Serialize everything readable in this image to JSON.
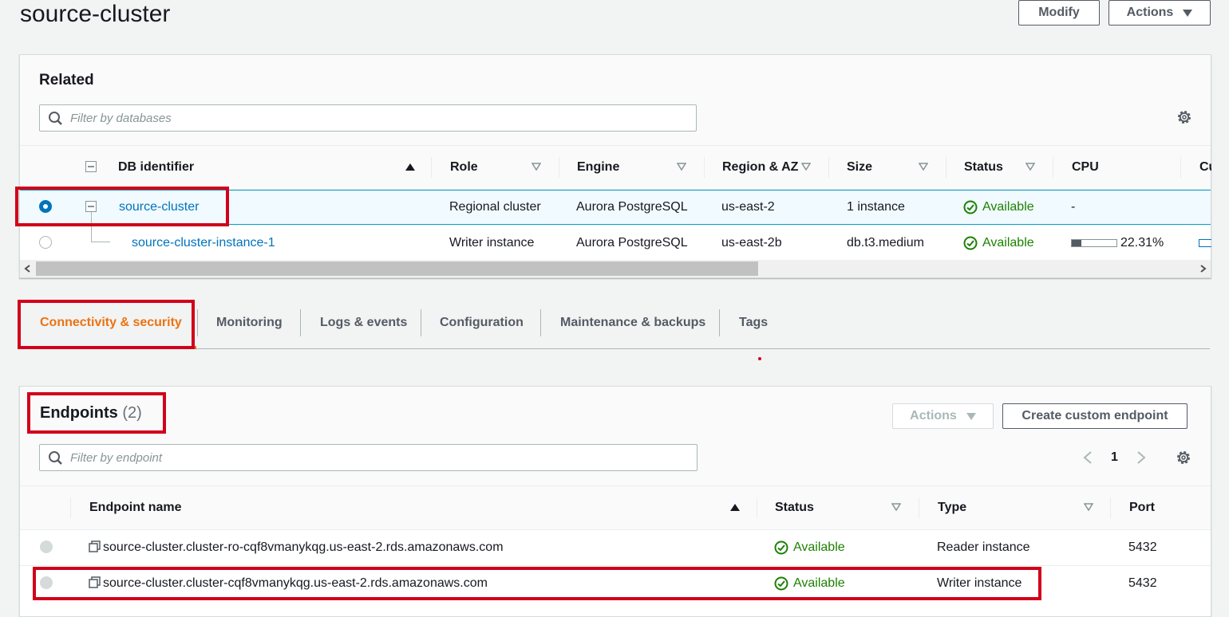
{
  "page": {
    "title": "source-cluster",
    "modify_label": "Modify",
    "actions_label": "Actions"
  },
  "related": {
    "heading": "Related",
    "filter_placeholder": "Filter by databases",
    "columns": [
      "DB identifier",
      "Role",
      "Engine",
      "Region & AZ",
      "Size",
      "Status",
      "CPU",
      "Cu"
    ],
    "rows": [
      {
        "id": "source-cluster",
        "role": "Regional cluster",
        "engine": "Aurora PostgreSQL",
        "region": "us-east-2",
        "size": "1 instance",
        "status": "Available",
        "cpu": "-"
      },
      {
        "id": "source-cluster-instance-1",
        "role": "Writer instance",
        "engine": "Aurora PostgreSQL",
        "region": "us-east-2b",
        "size": "db.t3.medium",
        "status": "Available",
        "cpu": "22.31%",
        "cpu_fraction": 0.2231
      }
    ]
  },
  "tabs": [
    "Connectivity & security",
    "Monitoring",
    "Logs & events",
    "Configuration",
    "Maintenance & backups",
    "Tags"
  ],
  "endpoints": {
    "heading": "Endpoints",
    "count": "(2)",
    "actions_label": "Actions",
    "create_label": "Create custom endpoint",
    "filter_placeholder": "Filter by endpoint",
    "page_number": "1",
    "columns": [
      "Endpoint name",
      "Status",
      "Type",
      "Port"
    ],
    "rows": [
      {
        "name": "source-cluster.cluster-ro-cqf8vmanykqg.us-east-2.rds.amazonaws.com",
        "status": "Available",
        "type": "Reader instance",
        "port": "5432"
      },
      {
        "name": "source-cluster.cluster-cqf8vmanykqg.us-east-2.rds.amazonaws.com",
        "status": "Available",
        "type": "Writer instance",
        "port": "5432"
      }
    ]
  },
  "colors": {
    "link": "#0073bb",
    "active_tab": "#ec7211",
    "available": "#1d8102",
    "highlight_box": "#d0021b",
    "selected_row_bg": "#f1faff"
  }
}
